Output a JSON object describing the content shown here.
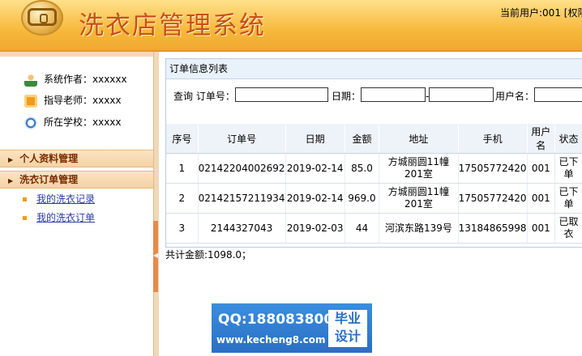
{
  "header": {
    "app_title": "洗衣店管理系统",
    "current_user": "当前用户:001 [权限"
  },
  "sidebar": {
    "info": [
      {
        "label": "系统作者：xxxxxx",
        "icon": "author-icon"
      },
      {
        "label": "指导老师：xxxxx",
        "icon": "teacher-icon"
      },
      {
        "label": "所在学校：xxxxx",
        "icon": "school-icon"
      }
    ],
    "sections": [
      {
        "label": "个人资料管理"
      },
      {
        "label": "洗衣订单管理"
      }
    ],
    "links": [
      {
        "label": "我的洗衣记录"
      },
      {
        "label": "我的洗衣订单"
      }
    ]
  },
  "panel": {
    "title": "订单信息列表",
    "search": {
      "order_label": "查询 订单号：",
      "date_label": "日期：",
      "date_separator": "-",
      "user_label": "用户名："
    },
    "columns": [
      "序号",
      "订单号",
      "日期",
      "金额",
      "地址",
      "手机",
      "用户名",
      "状态"
    ],
    "rows": [
      [
        "1",
        "02142204002692",
        "2019-02-14",
        "85.0",
        "方城丽圆11幢201室",
        "17505772420",
        "001",
        "已下单"
      ],
      [
        "2",
        "02142157211934",
        "2019-02-14",
        "969.0",
        "方城丽圆11幢201室",
        "17505772420",
        "001",
        "已下单"
      ],
      [
        "3",
        "2144327043",
        "2019-02-03",
        "44",
        "河滨东路139号",
        "13184865998",
        "001",
        "已取衣"
      ]
    ],
    "total": "共计金额:1098.0；"
  },
  "watermark": {
    "qq": "QQ:188083800",
    "url": "www.kecheng8.com",
    "badge_line1": "毕业",
    "badge_line2": "设计"
  }
}
